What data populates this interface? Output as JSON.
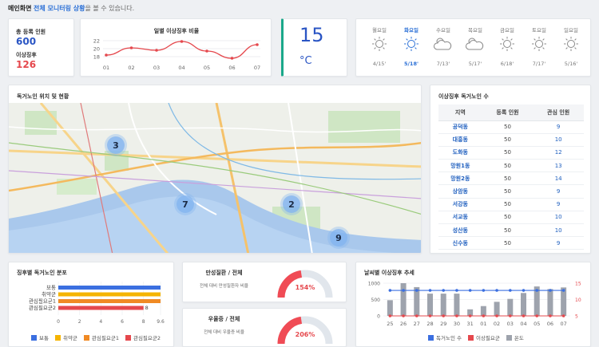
{
  "header": {
    "title": "메인화면",
    "desc_prefix": "전체 모니터링 상황",
    "desc_suffix": "을 볼 수 있습니다."
  },
  "summary": {
    "total_label": "총 등록 인원",
    "total_value": "600",
    "anomaly_label": "이상징후",
    "anomaly_value": "126"
  },
  "daily_chart": {
    "title": "일별 이상징후 비율",
    "chart_data": {
      "type": "line",
      "categories": [
        "01",
        "02",
        "03",
        "04",
        "05",
        "06",
        "07"
      ],
      "values": [
        18.4,
        20.2,
        19.6,
        21.8,
        19.4,
        17.6,
        21.0
      ],
      "yticks": [
        "22",
        "20",
        "18"
      ],
      "ylim": [
        17,
        23
      ],
      "color": "#e5484d"
    }
  },
  "temperature": {
    "value": "15",
    "unit": "°C"
  },
  "weather": [
    {
      "day": "월요일",
      "temp": "4/15'",
      "icon": "sun-icon",
      "active": false
    },
    {
      "day": "화요일",
      "temp": "5/18'",
      "icon": "sun-icon",
      "active": true
    },
    {
      "day": "수요일",
      "temp": "7/13'",
      "icon": "cloud-sun-icon",
      "active": false
    },
    {
      "day": "목요일",
      "temp": "5/17'",
      "icon": "cloud-sun-icon",
      "active": false
    },
    {
      "day": "금요일",
      "temp": "6/18'",
      "icon": "sun-icon",
      "active": false
    },
    {
      "day": "토요일",
      "temp": "7/17'",
      "icon": "sun-icon",
      "active": false
    },
    {
      "day": "일요일",
      "temp": "5/16'",
      "icon": "sun-icon",
      "active": false
    }
  ],
  "map": {
    "title": "독거노인 위치 및 현황",
    "markers": [
      "3",
      "7",
      "2",
      "9"
    ]
  },
  "anomaly_table": {
    "title": "이상징후 독거노인 수",
    "headers": [
      "지역",
      "등록 인원",
      "관심 인원"
    ],
    "rows": [
      [
        "공덕동",
        "50",
        "9"
      ],
      [
        "대흥동",
        "50",
        "10"
      ],
      [
        "도화동",
        "50",
        "12"
      ],
      [
        "망원1동",
        "50",
        "13"
      ],
      [
        "망원2동",
        "50",
        "14"
      ],
      [
        "상암동",
        "50",
        "9"
      ],
      [
        "서강동",
        "50",
        "9"
      ],
      [
        "서교동",
        "50",
        "10"
      ],
      [
        "성산동",
        "50",
        "10"
      ],
      [
        "신수동",
        "50",
        "9"
      ]
    ]
  },
  "distribution": {
    "title": "징후별 독거노인 분포",
    "chart_data": {
      "type": "bar",
      "orientation": "horizontal",
      "categories": [
        "보통",
        "취약군",
        "관심필요군1",
        "관심필요군2"
      ],
      "values": [
        9.6,
        9.6,
        9.6,
        8
      ],
      "value_labels": [
        "",
        "",
        "",
        "8"
      ],
      "xticks": [
        "0",
        "2",
        "4",
        "6",
        "8",
        "9.6"
      ],
      "xlim": [
        0,
        9.6
      ],
      "colors": [
        "#3b6fe0",
        "#f5b400",
        "#f08a24",
        "#e5484d"
      ]
    },
    "legend": [
      "보통",
      "취약군",
      "관심필요군1",
      "관심필요군2"
    ]
  },
  "chronic": {
    "title": "만성질환 / 전체",
    "desc": "전체 대비 만성질환자 비율",
    "value": "154%",
    "gauge_fraction": 1.0
  },
  "depression": {
    "title": "우울증 / 전체",
    "desc": "전체 대비 우울증 비율",
    "value": "206%",
    "gauge_fraction": 1.0
  },
  "weather_trend": {
    "title": "날씨별 이상징후 추세",
    "chart_data": {
      "type": "bar",
      "categories": [
        "25",
        "26",
        "27",
        "28",
        "29",
        "30",
        "31",
        "01",
        "02",
        "03",
        "04",
        "05",
        "06",
        "07"
      ],
      "bars": [
        480,
        1000,
        880,
        680,
        680,
        680,
        200,
        300,
        430,
        520,
        700,
        900,
        820,
        870
      ],
      "line_blue": [
        780,
        780,
        780,
        780,
        780,
        780,
        780,
        780,
        780,
        780,
        780,
        780,
        780,
        780
      ],
      "line_red": [
        0,
        0,
        0,
        0,
        0,
        0,
        0,
        0,
        0,
        0,
        0,
        0,
        0,
        0
      ],
      "yticks_left": [
        "1000",
        "500",
        "0"
      ],
      "yticks_right": [
        "15",
        "10",
        "5"
      ],
      "ylim": [
        0,
        1000
      ],
      "colors": {
        "bars": "#9ea3ad",
        "blue": "#3b6fe0",
        "red": "#e5484d"
      }
    },
    "legend": [
      "독거노인 수",
      "이상필요군",
      "온도"
    ]
  }
}
